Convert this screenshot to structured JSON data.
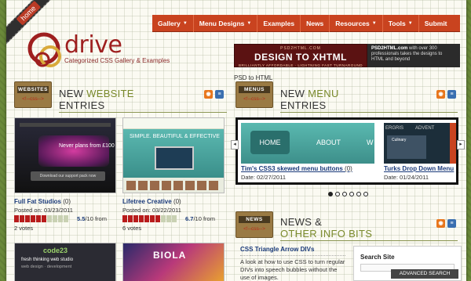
{
  "home_ribbon": "home",
  "nav": [
    {
      "label": "Gallery",
      "has_menu": true
    },
    {
      "label": "Menu Designs",
      "has_menu": true
    },
    {
      "label": "Examples",
      "has_menu": false
    },
    {
      "label": "News",
      "has_menu": false
    },
    {
      "label": "Resources",
      "has_menu": true
    },
    {
      "label": "Tools",
      "has_menu": true
    },
    {
      "label": "Submit",
      "has_menu": false
    }
  ],
  "logo": {
    "name": "drive",
    "tagline": "Categorized CSS Gallery & Examples"
  },
  "ad_left": {
    "small": "PSD2HTML.COM",
    "big": "DESIGN TO XHTML",
    "sub": "BRILLIANTLY AFFORDABLE · LIGHTNING FAST TURNAROUND"
  },
  "ad_right": {
    "brand": "PSD2HTML.com",
    "text": "with over 300 professionals takes the designs to HTML and beyond"
  },
  "ad_caption": "PSD to HTML",
  "websites": {
    "tag": "WEBSITES",
    "tag_sub": "<!--css-->",
    "title_prefix": "NEW ",
    "title_highlight": "WEBSITE",
    "title_line2": "ENTRIES",
    "thumb_a": {
      "text": "Never plans from £100",
      "button": "Download our support pack now"
    },
    "thumb_b": {
      "text": "SIMPLE. BEAUTIFUL & EFFECTIVE"
    },
    "entries": [
      {
        "title": "Full Fat Studios",
        "count": "(0)",
        "posted": "Posted on: 03/23/2011",
        "score": "5.5",
        "score_suffix": "/10 from",
        "votes": "2 votes",
        "rating": 0.55
      },
      {
        "title": "Lifetree Creative",
        "count": "(0)",
        "posted": "Posted on: 03/22/2011",
        "score": "6.7",
        "score_suffix": "/10 from",
        "votes": "6 votes",
        "rating": 0.67
      }
    ]
  },
  "menus": {
    "tag": "MENUS",
    "tag_sub": "<!--css-->",
    "title_prefix": "NEW ",
    "title_highlight": "MENU",
    "title_line2": "ENTRIES",
    "slide_a": {
      "home": "HOME",
      "about": "ABOUT",
      "extra": "W"
    },
    "slide_b": {
      "t1": "ERGRIS",
      "t2": "ADVENT",
      "dd": "Culinary"
    },
    "items": [
      {
        "title": "Tim's CSS3 skewed menu buttons",
        "count": "(0)",
        "date": "Date: 02/27/2011"
      },
      {
        "title": "Turks Drop Down Menu",
        "count": "",
        "date": "Date: 01/24/2011"
      }
    ],
    "dots_total": 6,
    "dots_active": 0,
    "prev_arrow": "◂",
    "next_arrow": "▸"
  },
  "news": {
    "tag": "NEWS",
    "tag_sub": "<!--css-->",
    "title_line1": "NEWS &",
    "title_line2": "OTHER INFO BITS",
    "item_title": "CSS Triangle Arrow DIVs",
    "item_body": "A look at how to use CSS to turn regular DIVs into speech bubbles without the use of images."
  },
  "search": {
    "label": "Search Site",
    "placeholder": "",
    "advanced": "ADVANCED SEARCH"
  },
  "bottom_thumbs": {
    "c": {
      "t": "code23",
      "t2": "fresh thinking web studio",
      "t3": "web design · development"
    },
    "d": {
      "t": "BIOLA"
    }
  },
  "icons": {
    "rss": "rss-icon",
    "share": "share-icon"
  },
  "colors": {
    "nav": "#c9431f",
    "accent_green": "#7a8a2c",
    "link": "#1a3a7a",
    "rating_on": "#b81c1c"
  }
}
